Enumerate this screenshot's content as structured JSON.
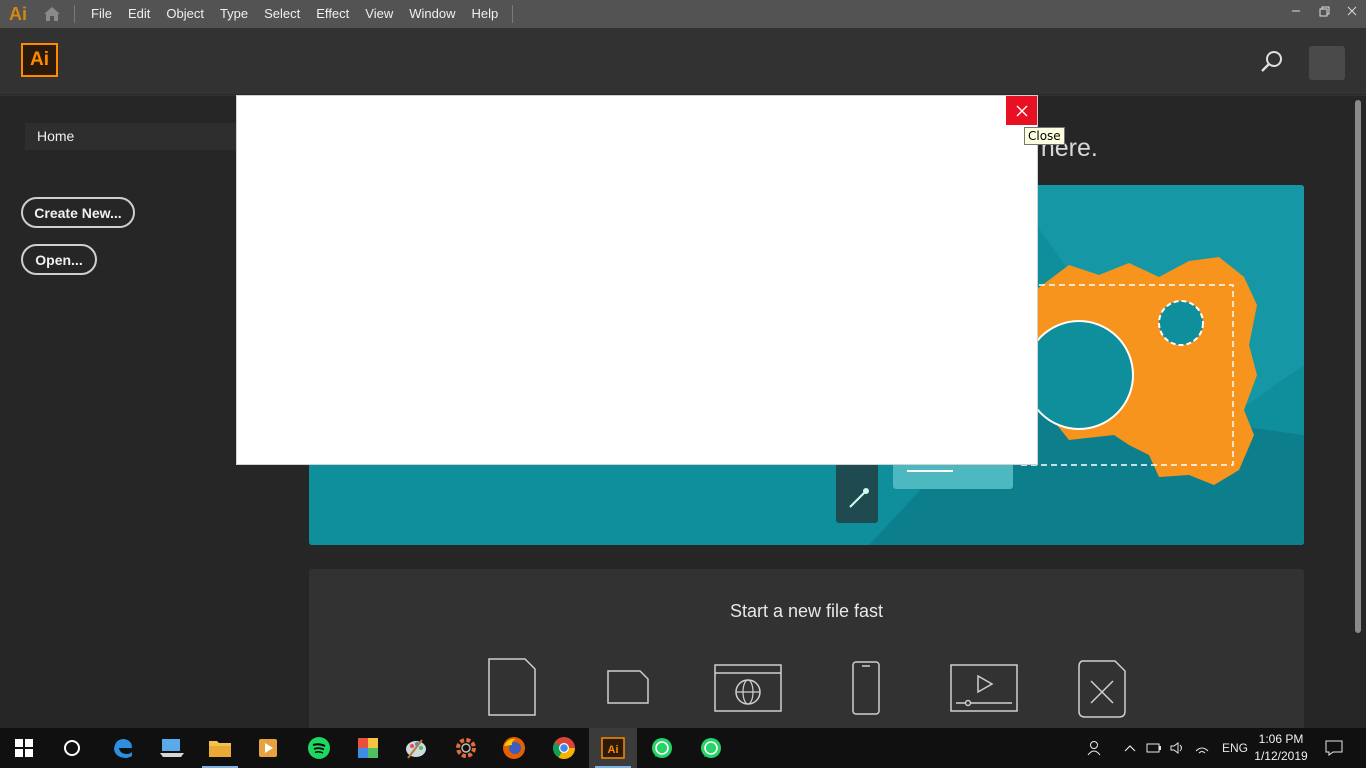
{
  "menubar": {
    "app_logo": "Ai",
    "items": [
      "File",
      "Edit",
      "Object",
      "Type",
      "Select",
      "Effect",
      "View",
      "Window",
      "Help"
    ]
  },
  "header": {
    "app_badge": "Ai"
  },
  "sidebar": {
    "home_label": "Home",
    "create_label": "Create New...",
    "open_label": "Open..."
  },
  "main": {
    "hero_text": "e here.",
    "quick_title": "Start a new file fast"
  },
  "modal": {
    "close_tooltip": "Close"
  },
  "taskbar": {
    "language": "ENG",
    "time": "1:06 PM",
    "date": "1/12/2019",
    "accent": "#7fb2e6"
  },
  "colors": {
    "illustrator_orange": "#ff8a00",
    "hero_teal": "#0f8e9c",
    "close_red": "#e81123"
  }
}
